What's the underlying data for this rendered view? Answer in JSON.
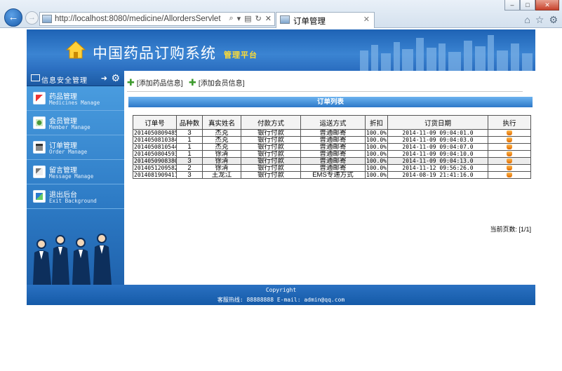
{
  "browser": {
    "url": "http://localhost:8080/medicine/AllordersServlet",
    "tab_title": "订单管理",
    "back_icon": "back-arrow-icon",
    "forward_icon": "forward-arrow-icon"
  },
  "banner": {
    "title": "中国药品订购系统",
    "subtitle": "管理平台"
  },
  "sidebar": {
    "header": "信息安全管理",
    "items": [
      {
        "label": "药品管理",
        "sub": "Medicines Manage",
        "icon": "medicine-icon"
      },
      {
        "label": "会员管理",
        "sub": "Member Manage",
        "icon": "member-icon"
      },
      {
        "label": "订单管理",
        "sub": "Order Manage",
        "icon": "order-icon"
      },
      {
        "label": "留言管理",
        "sub": "Message Manage",
        "icon": "message-icon"
      },
      {
        "label": "退出后台",
        "sub": "Exit Background",
        "icon": "exit-icon"
      }
    ]
  },
  "toolbar": {
    "add_medicine": "添加药品信息",
    "add_member": "添加会员信息"
  },
  "list_title": "订单列表",
  "table": {
    "headers": [
      "订单号",
      "品种数",
      "真实姓名",
      "付款方式",
      "运送方式",
      "折扣",
      "订货日期",
      "执行"
    ],
    "rows": [
      [
        "20140508094858",
        "3",
        "杰克",
        "银行付款",
        "普通邮寄",
        "100.0%",
        "2014-11-09 09:04:01.0"
      ],
      [
        "20140508103849",
        "1",
        "杰克",
        "银行付款",
        "普通邮寄",
        "100.0%",
        "2014-11-09 09:04:03.0"
      ],
      [
        "20140508105445",
        "1",
        "杰克",
        "银行付款",
        "普通邮寄",
        "100.0%",
        "2014-11-09 09:04:07.0"
      ],
      [
        "20140508045936",
        "1",
        "徐清",
        "银行付款",
        "普通邮寄",
        "100.0%",
        "2014-11-09 09:04:10.0"
      ],
      [
        "20140509083805",
        "3",
        "徐清",
        "银行付款",
        "普通邮寄",
        "100.0%",
        "2014-11-09 09:04:13.0"
      ],
      [
        "20140512095826",
        "2",
        "徐清",
        "银行付款",
        "普通邮寄",
        "100.0%",
        "2014-11-12 09:56:26.0"
      ],
      [
        "20140819094116",
        "3",
        "王龙江",
        "银行付款",
        "EMS专递方式",
        "100.0%",
        "2014-08-19 21:41:16.0"
      ]
    ]
  },
  "pager": "当前页数: [1/1]",
  "footer": {
    "line1": "Copyright",
    "line2": "客服热线: 88888888 E-mail: admin@qq.com"
  }
}
